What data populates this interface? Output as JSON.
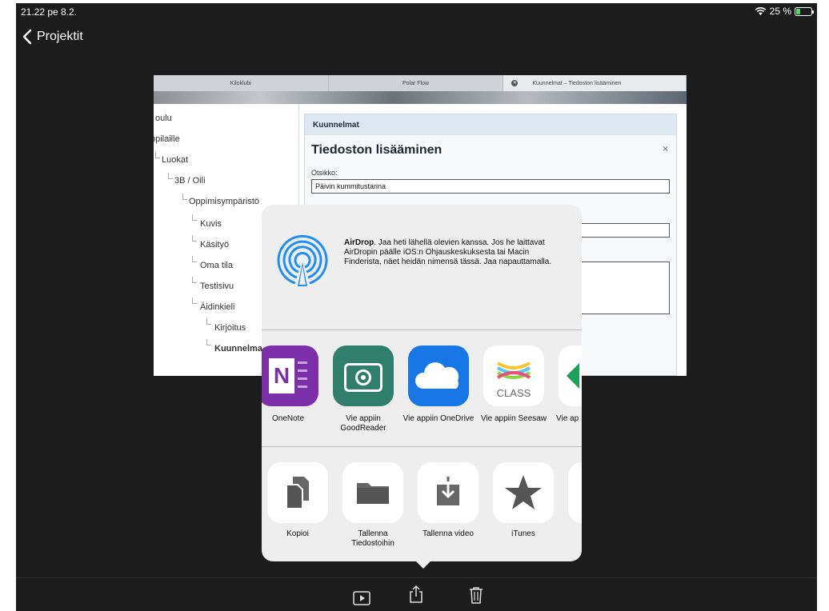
{
  "status": {
    "time": "21.22  pe 8.2.",
    "battery": "25 %",
    "battery_level": 0.25
  },
  "nav": {
    "back_label": "Projektit"
  },
  "preview": {
    "tabs": [
      "Kiloklubi",
      "Polar Flow",
      "Kuunnelmat – Tiedoston lisääminen"
    ],
    "tree": [
      "oulu",
      "ppilaille",
      "Luokat",
      "3B / Oili",
      "Oppimisympäristö",
      "Kuvis",
      "Käsityö",
      "Oma tila",
      "Testisivu",
      "Äidinkieli",
      "Kirjoitus",
      "Kuunnelma"
    ],
    "form": {
      "header": "Kuunnelmat",
      "title": "Tiedoston lisääminen",
      "close": "×",
      "label": "Otsikko:",
      "value": "Päivin kummitustarina"
    }
  },
  "share": {
    "airdrop": {
      "bold": "AirDrop",
      "text": ". Jaa heti lähellä olevien kanssa. Jos he laittavat AirDropin päälle iOS:n Ohjauskeskuksesta tai Macin Finderista, näet heidän nimensä tässä. Jaa napauttamalla."
    },
    "apps": [
      {
        "label": "OneNote",
        "icon": "onenote-icon"
      },
      {
        "label": "Vie appiin GoodReader",
        "icon": "goodreader-icon"
      },
      {
        "label": "Vie appiin OneDrive",
        "icon": "onedrive-icon"
      },
      {
        "label": "Vie appiin Seesaw",
        "icon": "seesaw-icon",
        "icon_text": "CLASS"
      },
      {
        "label": "Vie ap",
        "icon": "app-partial-icon"
      }
    ],
    "actions": [
      {
        "label": "Kopioi",
        "icon": "copy-icon"
      },
      {
        "label": "Tallenna Tiedostoihin",
        "icon": "folder-icon"
      },
      {
        "label": "Tallenna video",
        "icon": "download-icon"
      },
      {
        "label": "iTunes",
        "icon": "star-icon"
      }
    ]
  },
  "colors": {
    "background": "#1c1c1c",
    "sheet": "#eeeeef",
    "airdrop": "#1f8ff7",
    "onenote": "#7b2fa8",
    "goodreader": "#2f7f6b",
    "onedrive": "#1877e6"
  }
}
